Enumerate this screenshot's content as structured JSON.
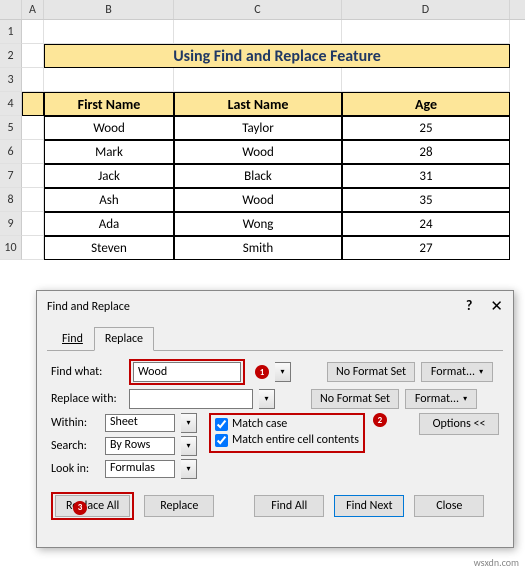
{
  "columns": [
    "A",
    "B",
    "C",
    "D"
  ],
  "rows": [
    "1",
    "2",
    "3",
    "4",
    "5",
    "6",
    "7",
    "8",
    "9",
    "10"
  ],
  "title": "Using Find and Replace Feature",
  "table": {
    "headers": {
      "first": "First Name",
      "last": "Last Name",
      "age": "Age"
    },
    "data": [
      {
        "first": "Wood",
        "last": "Taylor",
        "age": "25"
      },
      {
        "first": "Mark",
        "last": "Wood",
        "age": "28"
      },
      {
        "first": "Jack",
        "last": "Black",
        "age": "31"
      },
      {
        "first": "Ash",
        "last": "Wood",
        "age": "35"
      },
      {
        "first": "Ada",
        "last": "Wong",
        "age": "24"
      },
      {
        "first": "Steven",
        "last": "Smith",
        "age": "27"
      }
    ]
  },
  "dialog": {
    "title": "Find and Replace",
    "help": "?",
    "close": "✕",
    "tabs": {
      "find": "Find",
      "replace": "Replace"
    },
    "findwhat_lbl": "Find what:",
    "findwhat_val": "Wood",
    "replacewith_lbl": "Replace with:",
    "replacewith_val": "",
    "nofmt": "No Format Set",
    "format_btn": "Format...",
    "within_lbl": "Within:",
    "within_val": "Sheet",
    "search_lbl": "Search:",
    "search_val": "By Rows",
    "lookin_lbl": "Look in:",
    "lookin_val": "Formulas",
    "cb_matchcase": "Match case",
    "cb_entirecell": "Match entire cell contents",
    "options_btn": "Options <<",
    "btn_replaceall": "Replace All",
    "btn_replace": "Replace",
    "btn_findall": "Find All",
    "btn_findnext": "Find Next",
    "btn_close": "Close",
    "callouts": {
      "1": "1",
      "2": "2",
      "3": "3"
    }
  },
  "watermark": "wsxdn.com"
}
